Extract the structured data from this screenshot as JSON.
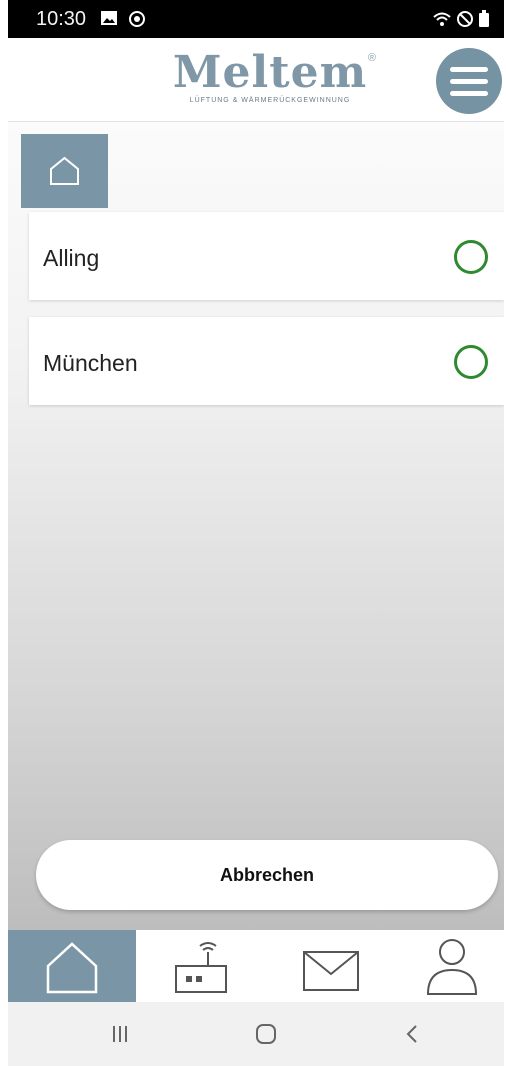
{
  "status_bar": {
    "time": "10:30",
    "left_icons": [
      "image-icon",
      "app-icon"
    ],
    "right_icons": [
      "wifi-icon",
      "dnd-icon",
      "battery-icon"
    ]
  },
  "header": {
    "logo_text": "Meltem",
    "logo_tagline": "LÜFTUNG & WÄRMERÜCKGEWINNUNG",
    "menu_icon": "hamburger-icon"
  },
  "colors": {
    "brand": "#7a96a6",
    "status_ok": "#2f8a2f"
  },
  "breadcrumb": {
    "home_icon": "home-icon"
  },
  "locations": [
    {
      "name": "Alling",
      "status_icon": "status-circle-icon"
    },
    {
      "name": "München",
      "status_icon": "status-circle-icon"
    }
  ],
  "actions": {
    "cancel_label": "Abbrechen"
  },
  "bottom_nav": [
    {
      "icon": "home-icon",
      "active": true
    },
    {
      "icon": "router-icon",
      "active": false
    },
    {
      "icon": "mail-icon",
      "active": false
    },
    {
      "icon": "user-icon",
      "active": false
    }
  ],
  "system_nav": [
    "recent-apps-icon",
    "home-button-icon",
    "back-icon"
  ]
}
